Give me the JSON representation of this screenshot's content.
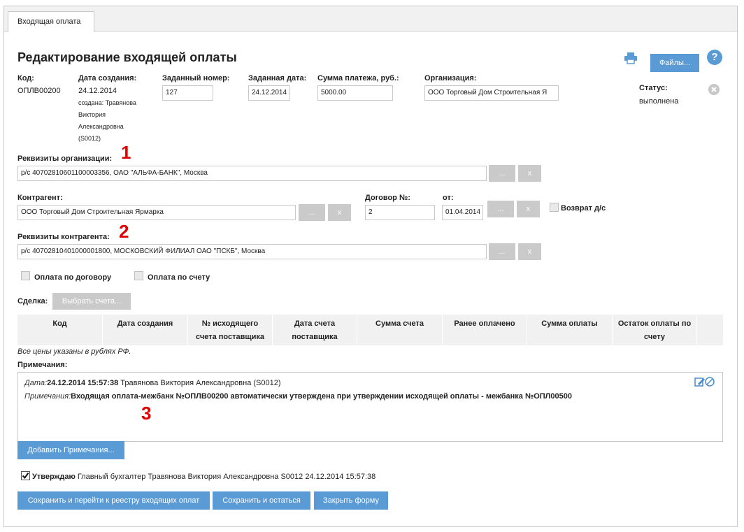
{
  "tab": {
    "label": "Входящая оплата"
  },
  "page_title": "Редактирование входящей оплаты",
  "toolbar": {
    "files_label": "Файлы...",
    "help_label": "?"
  },
  "header": {
    "code_label": "Код:",
    "code_value": "ОПЛВ00200",
    "created_label": "Дата создания:",
    "created_date": "24.12.2014",
    "created_by_lines": [
      "создана: Травянова",
      "Виктория",
      "Александровна",
      "(S0012)"
    ],
    "assigned_number_label": "Заданный номер:",
    "assigned_number_value": "127",
    "assigned_date_label": "Заданная дата:",
    "assigned_date_value": "24.12.2014",
    "sum_label": "Сумма платежа, руб.:",
    "sum_value": "5000.00",
    "org_label": "Организация:",
    "org_value": "ООО Торговый Дом Строительная Я",
    "status_label": "Статус:",
    "status_value": "выполнена"
  },
  "org_requisites": {
    "label": "Реквизиты организации:",
    "value": "р/с 40702810601100003356, ОАО \"АЛЬФА-БАНК\", Москва",
    "dots": "...",
    "x": "x",
    "marker": "1"
  },
  "counterparty": {
    "label": "Контрагент:",
    "value": "ООО Торговый Дом Строительная Ярмарка",
    "dots": "...",
    "x": "x"
  },
  "contract": {
    "label": "Договор №:",
    "value": "2",
    "from_label": "от:",
    "from_value": "01.04.2014",
    "dots": "...",
    "x": "x",
    "refund_label": "Возврат д/с"
  },
  "cp_requisites": {
    "label": "Реквизиты контрагента:",
    "value": "р/с 40702810401000001800, МОСКОВСКИЙ ФИЛИАЛ ОАО \"ПСКБ\", Москва",
    "dots": "...",
    "x": "x",
    "marker": "2"
  },
  "checkboxes": {
    "by_contract": "Оплата по договору",
    "by_invoice": "Оплата по счету"
  },
  "deal": {
    "label": "Сделка:",
    "select_label": "Выбрать счета..."
  },
  "table": {
    "columns": [
      [
        "Код"
      ],
      [
        "Дата создания"
      ],
      [
        "№ исходящего",
        "счета поставщика"
      ],
      [
        "Дата счета",
        "поставщика"
      ],
      [
        "Сумма счета"
      ],
      [
        "Ранее оплачено"
      ],
      [
        "Сумма оплаты"
      ],
      [
        "Остаток оплаты по",
        "счету"
      ]
    ],
    "footnote": "Все цены указаны в рублях РФ."
  },
  "notes": {
    "label": "Примечания:",
    "date_prefix": "Дата:",
    "date_value": "24.12.2014 15:57:38",
    "author": "Травянова Виктория Александровна (S0012)",
    "note_prefix": "Примечания:",
    "note_text": "Входящая оплата-межбанк №ОПЛВ00200 автоматически утверждена при утверждении исходящей оплаты - межбанка №ОПЛ00500",
    "marker": "3",
    "add_label": "Добавить Примечания..."
  },
  "approve": {
    "label": "Утверждаю",
    "text": "Главный бухгалтер Травянова Виктория Александровна S0012 24.12.2014 15:57:38",
    "checked": true
  },
  "actions": {
    "save_go": "Сохранить и перейти к реестру входящих оплат",
    "save_stay": "Сохранить и остаться",
    "close": "Закрыть форму"
  },
  "colors": {
    "accent": "#5b9bd5",
    "disabled": "#cacaca",
    "marker": "#e00000",
    "header_bg": "#f1f1f1"
  },
  "icons": {
    "print": "printer-icon",
    "help": "help-icon",
    "status_clear": "close-circle-icon",
    "notes_edit": "edit-note-icon"
  }
}
